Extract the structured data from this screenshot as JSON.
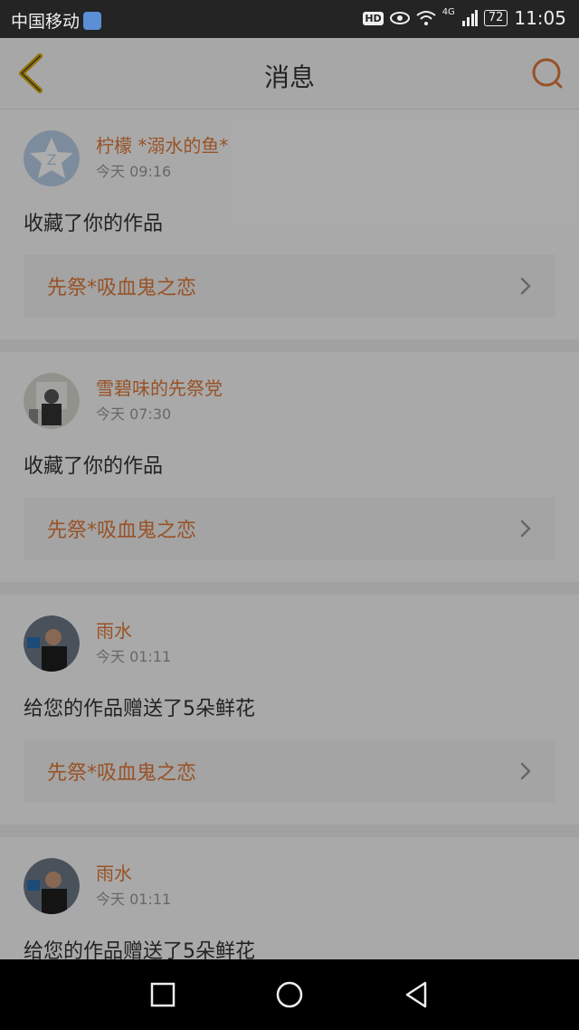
{
  "status_bar": {
    "carrier": "中国移动",
    "hd": "HD",
    "network": "4G",
    "battery": "72",
    "time": "11:05"
  },
  "header": {
    "title": "消息"
  },
  "messages": [
    {
      "user": "柠檬 *溺水的鱼*",
      "time": "今天 09:16",
      "action": "收藏了你的作品",
      "work": "先祭*吸血鬼之恋",
      "avatar": "qq-default-avatar"
    },
    {
      "user": "雪碧味的先祭党",
      "time": "今天 07:30",
      "action": "收藏了你的作品",
      "work": "先祭*吸血鬼之恋",
      "avatar": "user-photo"
    },
    {
      "user": "雨水",
      "time": "今天 01:11",
      "action": "给您的作品赠送了5朵鲜花",
      "work": "先祭*吸血鬼之恋",
      "avatar": "user-photo"
    },
    {
      "user": "雨水",
      "time": "今天 01:11",
      "action": "给您的作品赠送了5朵鲜花",
      "work": "",
      "avatar": "user-photo"
    }
  ],
  "colors": {
    "accent": "#e07a3a",
    "back_icon": "#d9a800"
  }
}
